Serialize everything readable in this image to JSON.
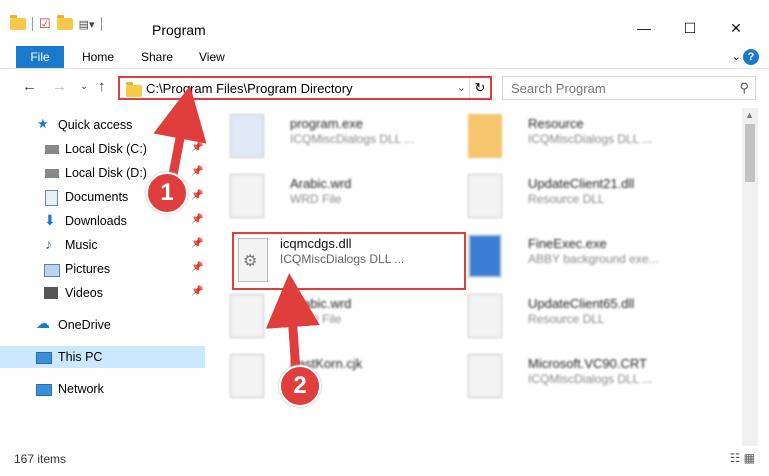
{
  "window": {
    "title": "Program",
    "controls": {
      "minimize": "—",
      "maximize": "☐",
      "close": "✕"
    }
  },
  "ribbon": {
    "tabs": [
      "File",
      "Home",
      "Share",
      "View"
    ],
    "help_label": "?"
  },
  "navigation": {
    "address": "C:\\Program Files\\Program Directory",
    "search_placeholder": "Search Program"
  },
  "sidebar": {
    "items": [
      {
        "label": "Quick access",
        "icon": "star-icon",
        "pinned": false
      },
      {
        "label": "Local Disk (C:)",
        "icon": "drive-icon",
        "pinned": true
      },
      {
        "label": "Local Disk (D:)",
        "icon": "drive-icon",
        "pinned": true
      },
      {
        "label": "Documents",
        "icon": "documents-icon",
        "pinned": true
      },
      {
        "label": "Downloads",
        "icon": "download-icon",
        "pinned": true
      },
      {
        "label": "Music",
        "icon": "music-icon",
        "pinned": true
      },
      {
        "label": "Pictures",
        "icon": "pictures-icon",
        "pinned": true
      },
      {
        "label": "Videos",
        "icon": "videos-icon",
        "pinned": true
      },
      {
        "label": "OneDrive",
        "icon": "cloud-icon",
        "pinned": false
      },
      {
        "label": "This PC",
        "icon": "computer-icon",
        "pinned": false,
        "selected": true
      },
      {
        "label": "Network",
        "icon": "network-icon",
        "pinned": false
      }
    ]
  },
  "files": [
    {
      "name": "program.exe",
      "desc": "ICQMiscDialogs DLL ..."
    },
    {
      "name": "Resource",
      "desc": "ICQMiscDialogs DLL ..."
    },
    {
      "name": "Arabic.wrd",
      "desc": "WRD File"
    },
    {
      "name": "UpdateClient21.dll",
      "desc": "Resource DLL"
    },
    {
      "name": "FineExec.exe",
      "desc": "ABBY background exe..."
    },
    {
      "name": "Arabic.wrd",
      "desc": "WRD File"
    },
    {
      "name": "UpdateClient65.dll",
      "desc": "Resource DLL"
    },
    {
      "name": "FastKorn.cjk",
      "desc": ""
    },
    {
      "name": "Microsoft.VC90.CRT",
      "desc": "ICQMiscDialogs DLL ..."
    }
  ],
  "highlighted_file": {
    "name": "icqmcdgs.dll",
    "desc": "ICQMiscDialogs DLL ..."
  },
  "annotations": {
    "step1": "1",
    "step2": "2"
  },
  "status": {
    "count": "167 items"
  },
  "colors": {
    "accent": "#1979ca",
    "highlight": "#e03d3d",
    "selected": "#cce8ff"
  }
}
